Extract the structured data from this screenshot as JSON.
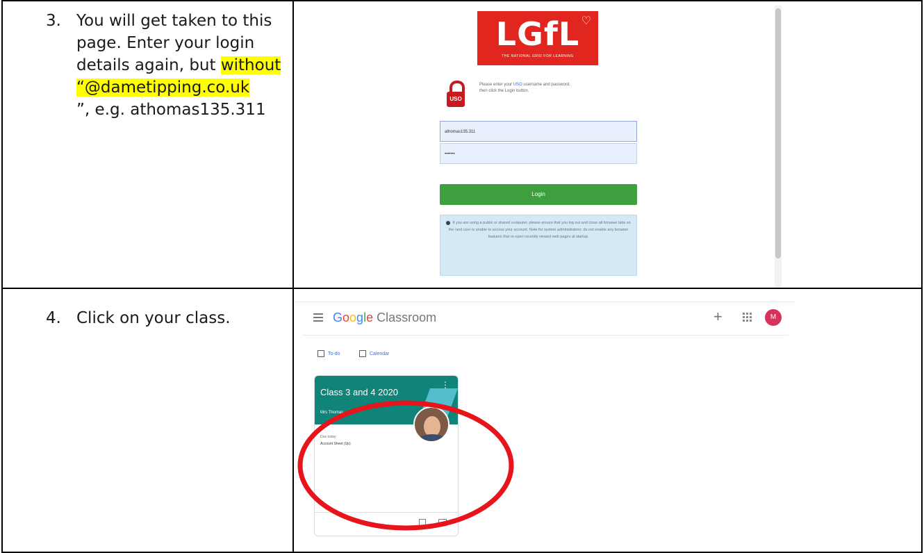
{
  "steps": [
    {
      "number": "3.",
      "text_before": "You will get taken to this page. Enter your login details again, but ",
      "highlight_1": "without",
      "highlight_2": "“@dametipping.co.uk",
      "text_after": "”, e.g. athomas135.311"
    },
    {
      "number": "4.",
      "text": "Click on your class."
    }
  ],
  "login_page": {
    "logo_text": "LGfL",
    "logo_tagline": "THE NATIONAL GRID FOR LEARNING",
    "lock_badge": "USO",
    "intro_line1_pre": "Please enter your ",
    "intro_link": "USO",
    "intro_line1_post": " username and password,",
    "intro_line2": "then click the Login button.",
    "username_value": "athomas135.311",
    "password_value": "•••••••",
    "login_button": "Login",
    "notice": "If you are using a public or shared computer, please ensure that you log out and close all browser tabs so the next user is unable to access your account. Note for system administrators: do not enable any browser features that re-open recently viewed web pages at startup."
  },
  "classroom": {
    "brand_google": [
      "G",
      "o",
      "o",
      "g",
      "l",
      "e"
    ],
    "brand_product": "Classroom",
    "user_initial": "M",
    "nav_todo": "To-do",
    "nav_calendar": "Calendar",
    "card_title": "Class 3 and 4 2020",
    "card_teacher": "Mrs Thomas",
    "due_label": "Due today",
    "due_item": "Account Sheet (Up)"
  },
  "colors": {
    "highlight": "#ffff00",
    "lgfl_red": "#e0261f",
    "login_green": "#3f9f3f",
    "card_teal": "#11847a",
    "annotation_red": "#e8141b"
  }
}
